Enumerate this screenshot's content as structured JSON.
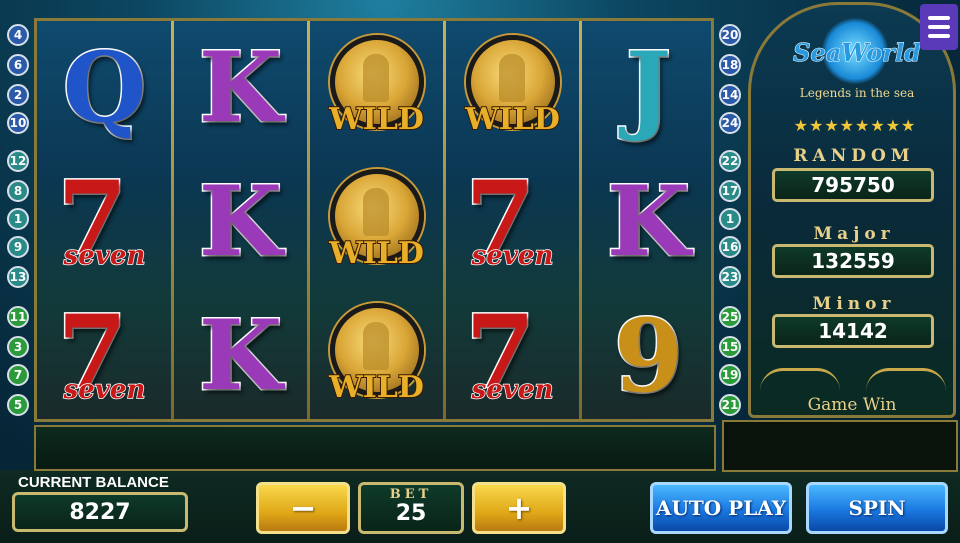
{
  "reels": [
    [
      "Q",
      "7",
      "7"
    ],
    [
      "K",
      "K",
      "K"
    ],
    [
      "WILD",
      "WILD",
      "WILD"
    ],
    [
      "WILD",
      "7",
      "7"
    ],
    [
      "J",
      "K",
      "9"
    ]
  ],
  "symbols": {
    "seven_word": "seven",
    "wild_word": "WILD"
  },
  "paylines_left": [
    "4",
    "6",
    "2",
    "10",
    "12",
    "8",
    "1",
    "9",
    "13",
    "11",
    "3",
    "7",
    "5"
  ],
  "paylines_right": [
    "20",
    "18",
    "14",
    "24",
    "22",
    "17",
    "1",
    "16",
    "23",
    "25",
    "15",
    "19",
    "21"
  ],
  "logo": {
    "title": "SeaWorld",
    "tagline": "Legends in the sea",
    "stars": "★★★★★★★★"
  },
  "jackpots": {
    "random_label": "RANDOM",
    "random_value": "795750",
    "major_label": "Major",
    "major_value": "132559",
    "minor_label": "Minor",
    "minor_value": "14142"
  },
  "game_win_label": "Game Win",
  "balance": {
    "label": "CURRENT BALANCE",
    "value": "8227"
  },
  "bet": {
    "label": "BET",
    "value": "25",
    "minus": "−",
    "plus": "+"
  },
  "buttons": {
    "auto_play": "AUTO PLAY",
    "spin": "SPIN"
  },
  "colors": {
    "accent_gold": "#e0a818",
    "accent_blue": "#1a78e0",
    "panel_border": "#8a7a3a"
  }
}
